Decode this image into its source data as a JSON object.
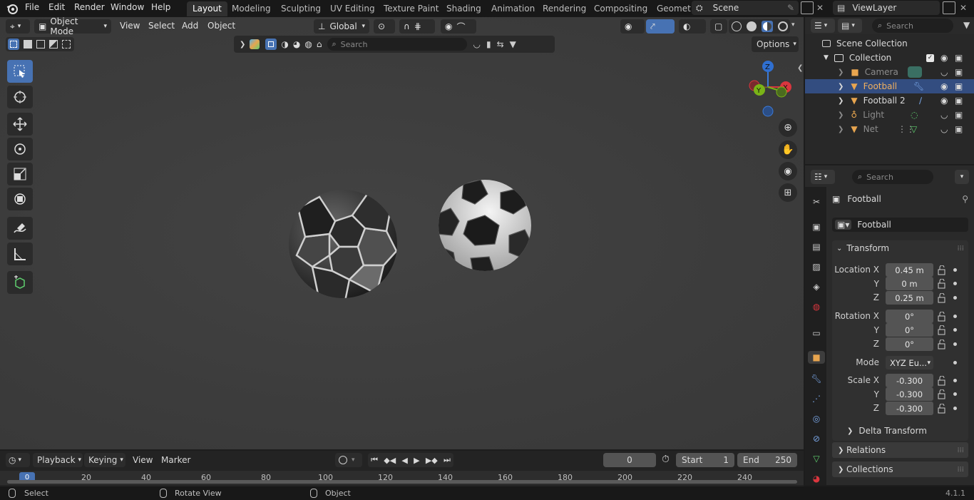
{
  "menu": [
    "File",
    "Edit",
    "Render",
    "Window",
    "Help"
  ],
  "workspaces": [
    "Layout",
    "Modeling",
    "Sculpting",
    "UV Editing",
    "Texture Paint",
    "Shading",
    "Animation",
    "Rendering",
    "Compositing",
    "Geomet"
  ],
  "scene": {
    "name": "Scene"
  },
  "view_layer": {
    "name": "ViewLayer"
  },
  "viewport_header": {
    "mode": "Object Mode",
    "menus": [
      "View",
      "Select",
      "Add",
      "Object"
    ],
    "orientation": "Global",
    "search_placeholder": "Search",
    "options": "Options"
  },
  "outliner": {
    "search_placeholder": "Search",
    "root": "Scene Collection",
    "collection": "Collection",
    "items": [
      {
        "name": "Camera",
        "selected": false
      },
      {
        "name": "Football",
        "selected": true
      },
      {
        "name": "Football 2",
        "selected": false
      },
      {
        "name": "Light",
        "selected": false
      },
      {
        "name": "Net",
        "selected": false
      }
    ]
  },
  "properties": {
    "search_placeholder": "Search",
    "object_name": "Football",
    "data_name": "Football",
    "transform_label": "Transform",
    "location": {
      "label_x": "Location X",
      "label_y": "Y",
      "label_z": "Z",
      "x": "0.45 m",
      "y": "0 m",
      "z": "0.25 m"
    },
    "rotation": {
      "label_x": "Rotation X",
      "label_y": "Y",
      "label_z": "Z",
      "x": "0°",
      "y": "0°",
      "z": "0°"
    },
    "mode": {
      "label": "Mode",
      "value": "XYZ Eu..."
    },
    "scale": {
      "label_x": "Scale X",
      "label_y": "Y",
      "label_z": "Z",
      "x": "-0.300",
      "y": "-0.300",
      "z": "-0.300"
    },
    "delta_transform": "Delta Transform",
    "relations": "Relations",
    "collections": "Collections"
  },
  "timeline": {
    "menus": [
      "Playback",
      "Keying",
      "View",
      "Marker"
    ],
    "current_frame": "0",
    "start_label": "Start",
    "start": "1",
    "end_label": "End",
    "end": "250",
    "ruler": [
      "0",
      "20",
      "40",
      "60",
      "80",
      "100",
      "120",
      "140",
      "160",
      "180",
      "200",
      "220",
      "240"
    ]
  },
  "status": {
    "select": "Select",
    "rotate": "Rotate View",
    "object": "Object",
    "version": "4.1.1"
  },
  "colors": {
    "accent": "#4772b3",
    "selected_row": "#334d80",
    "viewport_bg": "#3e3e3e"
  }
}
